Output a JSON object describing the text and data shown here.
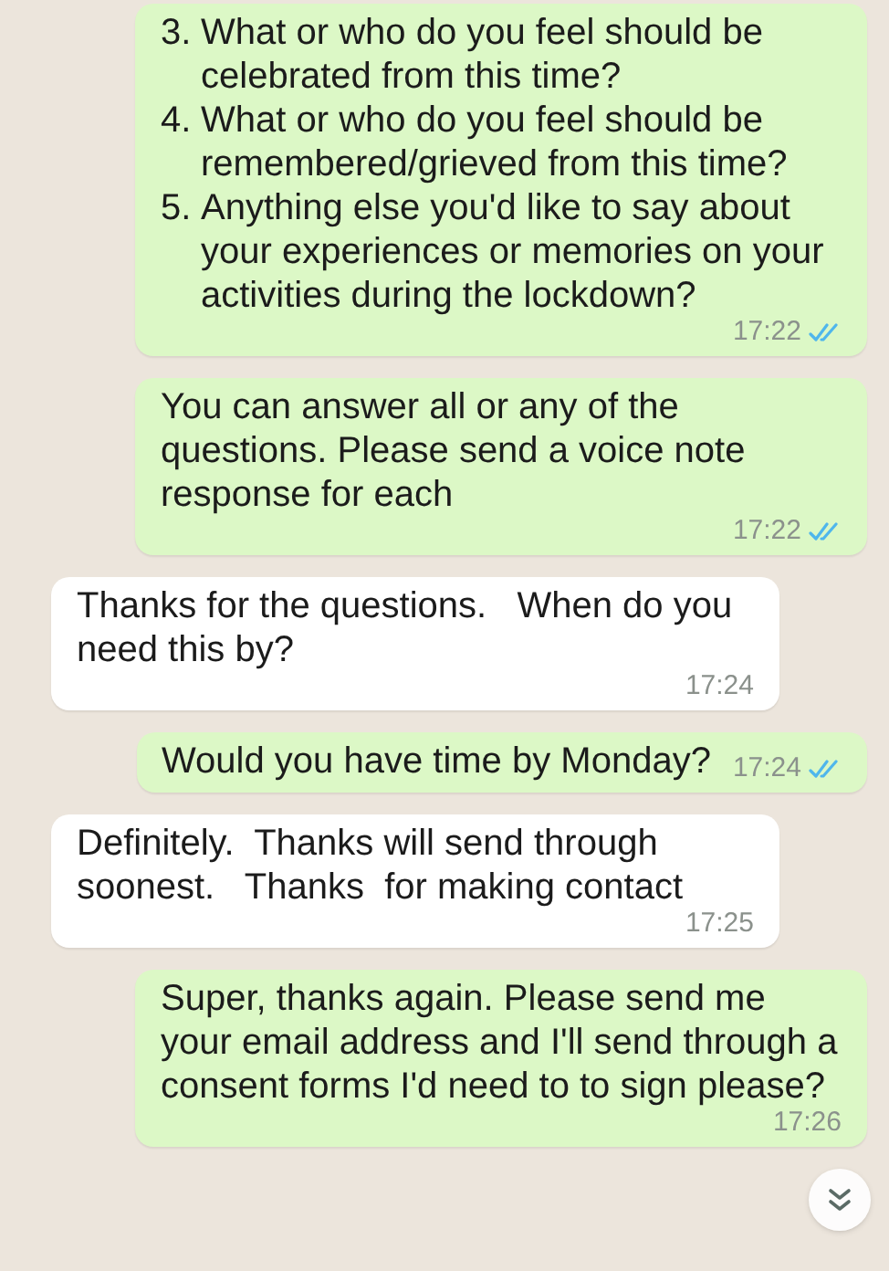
{
  "messages": [
    {
      "kind": "sent",
      "items": [
        {
          "number": "3.",
          "text": "What or who do you feel should be celebrated from this time?"
        },
        {
          "number": "4.",
          "text": "What or who do you feel should be remembered/grieved from this time?"
        },
        {
          "number": "5.",
          "text": "Anything else you'd like to say about your experiences or memories on your activities during the lockdown?"
        }
      ],
      "time": "17:22",
      "read": true
    },
    {
      "kind": "sent",
      "text": "You can answer all or any of the questions. Please send a voice note response for each",
      "time": "17:22",
      "read": true
    },
    {
      "kind": "received",
      "text": "Thanks for the questions.   When do you need this by?",
      "time": "17:24"
    },
    {
      "kind": "sent",
      "text": "Would you have time by Monday?",
      "time": "17:24",
      "read": true
    },
    {
      "kind": "received",
      "text": "Definitely.  Thanks will send through soonest.   Thanks  for making contact",
      "time": "17:25"
    },
    {
      "kind": "sent",
      "text": "Super, thanks again. Please send me your email address and I'll send through a consent forms I'd need to to sign please?",
      "time": "17:26"
    }
  ]
}
